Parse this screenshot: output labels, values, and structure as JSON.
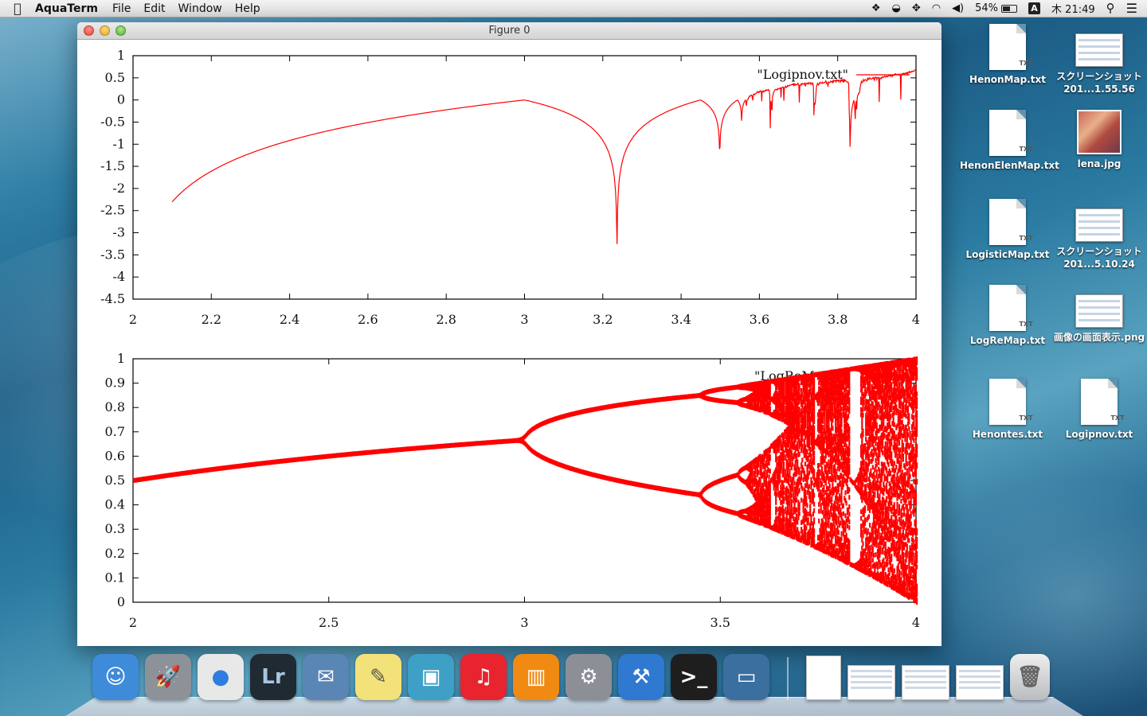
{
  "menubar": {
    "app_name": "AquaTerm",
    "menus": [
      "File",
      "Edit",
      "Window",
      "Help"
    ],
    "battery": "54%",
    "input_method": "A",
    "clock": "木 21:49"
  },
  "window": {
    "title": "Figure 0"
  },
  "chart_data": [
    {
      "type": "line",
      "legend": "\"Logipnov.txt\"",
      "color": "#ff0000",
      "xlim": [
        2,
        4
      ],
      "ylim": [
        -4.5,
        1
      ],
      "xticks": [
        "2",
        "2.2",
        "2.4",
        "2.6",
        "2.8",
        "3",
        "3.2",
        "3.4",
        "3.6",
        "3.8",
        "4"
      ],
      "yticks": [
        "1",
        "0.5",
        "0",
        "-0.5",
        "-1",
        "-1.5",
        "-2",
        "-2.5",
        "-3",
        "-3.5",
        "-4",
        "-4.5"
      ],
      "x": [
        2.1,
        2.2,
        2.3,
        2.4,
        2.5,
        2.6,
        2.7,
        2.8,
        2.9,
        3.0,
        3.1,
        3.2,
        3.236,
        3.3,
        3.4,
        3.45,
        3.5,
        3.56,
        3.6,
        3.7,
        3.8,
        3.83,
        3.9,
        4.0
      ],
      "y": [
        -2.3,
        -1.6,
        -1.2,
        -0.9,
        -0.68,
        -0.5,
        -0.35,
        -0.22,
        -0.1,
        0.0,
        -0.35,
        -1.3,
        -4.0,
        -1.0,
        -0.15,
        0.0,
        -1.2,
        -0.4,
        -0.1,
        0.15,
        0.3,
        -1.3,
        0.45,
        0.65
      ]
    },
    {
      "type": "scatter",
      "legend": "\"LogReM",
      "color": "#ff0000",
      "xlim": [
        2,
        4
      ],
      "ylim": [
        0,
        1
      ],
      "xticks": [
        "2",
        "2.5",
        "3",
        "3.5",
        "4"
      ],
      "yticks": [
        "1",
        "0.9",
        "0.8",
        "0.7",
        "0.6",
        "0.5",
        "0.4",
        "0.3",
        "0.2",
        "0.1",
        "0"
      ],
      "description": "bifurcation diagram of logistic map, x = r, y = population"
    }
  ],
  "desktop_icons": [
    {
      "label": "HenonMap.txt",
      "kind": "txt"
    },
    {
      "label": "スクリーンショット 201...1.55.56",
      "kind": "screenshot"
    },
    {
      "label": "HenonElenMap.txt",
      "kind": "txt"
    },
    {
      "label": "lena.jpg",
      "kind": "photo"
    },
    {
      "label": "LogisticMap.txt",
      "kind": "txt"
    },
    {
      "label": "スクリーンショット 201...5.10.24",
      "kind": "screenshot"
    },
    {
      "label": "LogReMap.txt",
      "kind": "txt"
    },
    {
      "label": "画像の画面表示.png",
      "kind": "screenshot"
    },
    {
      "label": "Henontes.txt",
      "kind": "txt"
    },
    {
      "label": "Logipnov.txt",
      "kind": "txt"
    }
  ],
  "doc_ext": "TXT",
  "dock": {
    "apps": [
      {
        "name": "finder",
        "glyph": "☺",
        "color": "#3d8bd9"
      },
      {
        "name": "launchpad",
        "glyph": "🚀",
        "color": "#8d9299"
      },
      {
        "name": "chrome",
        "glyph": "●",
        "color": "#e8e8e8"
      },
      {
        "name": "lightroom",
        "glyph": "Lr",
        "color": "#1f2a33"
      },
      {
        "name": "mail",
        "glyph": "✉",
        "color": "#5a86b6"
      },
      {
        "name": "notes",
        "glyph": "✎",
        "color": "#f3e27a"
      },
      {
        "name": "iphoto",
        "glyph": "▣",
        "color": "#3ea0c6"
      },
      {
        "name": "itunes",
        "glyph": "♫",
        "color": "#e8242f"
      },
      {
        "name": "ibooks",
        "glyph": "▥",
        "color": "#f08a12"
      },
      {
        "name": "system-preferences",
        "glyph": "⚙",
        "color": "#8c9096"
      },
      {
        "name": "xcode",
        "glyph": "⚒",
        "color": "#2f79d0"
      },
      {
        "name": "terminal",
        "glyph": ">_",
        "color": "#1e1e1e"
      },
      {
        "name": "preview",
        "glyph": "▭",
        "color": "#3a6fa0"
      }
    ]
  }
}
